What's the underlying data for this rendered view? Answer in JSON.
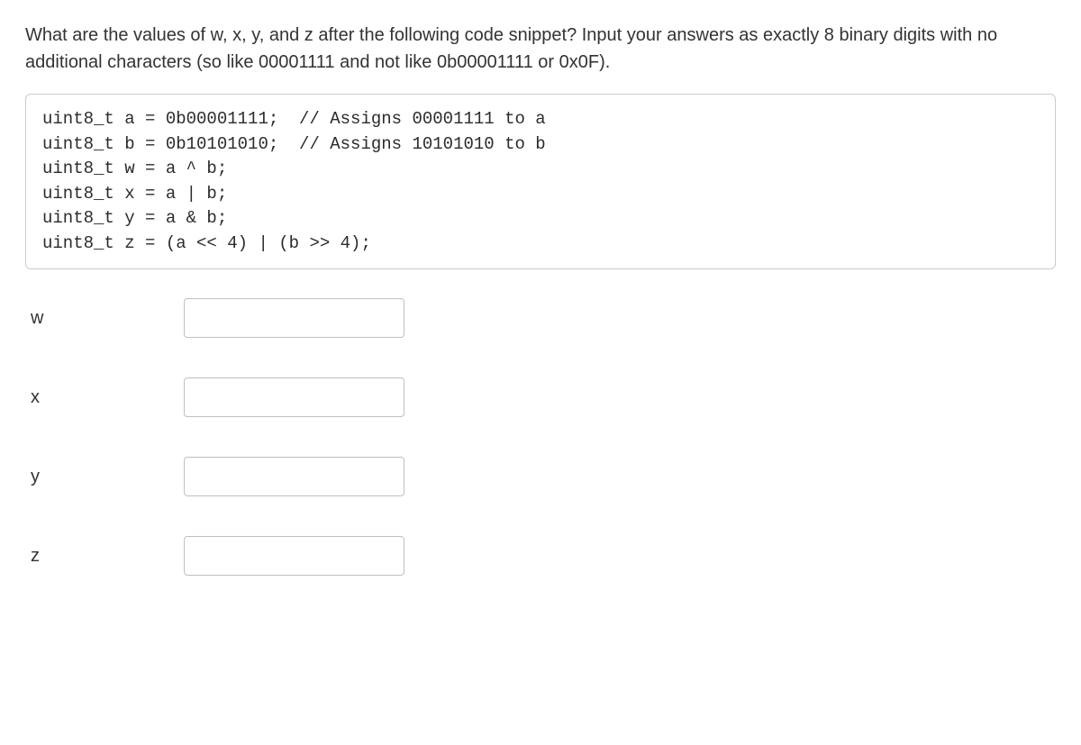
{
  "question": {
    "text": "What are the values of w, x, y, and z after the following code snippet? Input your answers as exactly 8 binary digits with no additional characters (so like 00001111 and not like 0b00001111 or 0x0F)."
  },
  "code": {
    "line1": "uint8_t a = 0b00001111;  // Assigns 00001111 to a",
    "line2": "uint8_t b = 0b10101010;  // Assigns 10101010 to b",
    "line3": "uint8_t w = a ^ b;",
    "line4": "uint8_t x = a | b;",
    "line5": "uint8_t y = a & b;",
    "line6": "uint8_t z = (a << 4) | (b >> 4);"
  },
  "answers": {
    "w": {
      "label": "w",
      "value": ""
    },
    "x": {
      "label": "x",
      "value": ""
    },
    "y": {
      "label": "y",
      "value": ""
    },
    "z": {
      "label": "z",
      "value": ""
    }
  }
}
